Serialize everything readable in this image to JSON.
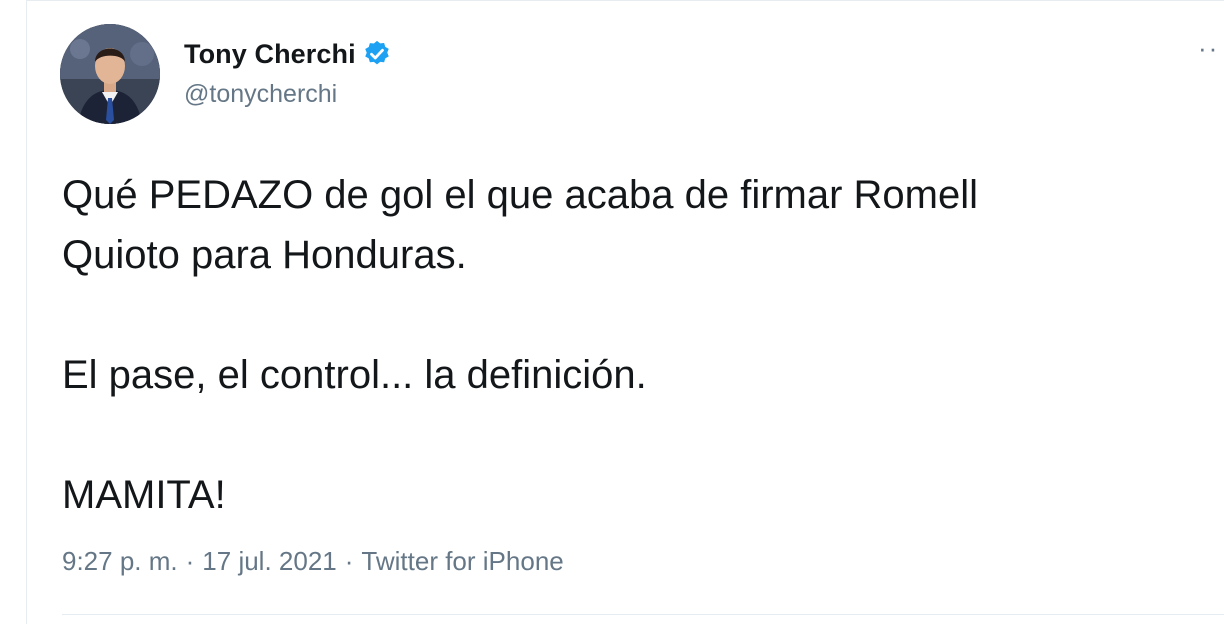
{
  "author": {
    "display_name": "Tony Cherchi",
    "handle": "@tonycherchi",
    "verified": true,
    "avatar_icon": "profile-photo"
  },
  "more_menu": {
    "label": "··",
    "icon": "more-horizontal-icon"
  },
  "tweet": {
    "line1": "Qué PEDAZO de gol el que acaba de firmar Romell",
    "line2": "Quioto para Honduras.",
    "line3": "El pase, el control... la definición.",
    "line4": "MAMITA!"
  },
  "meta": {
    "time": "9:27 p. m.",
    "separator": "·",
    "date": "17 jul. 2021",
    "source": "Twitter for iPhone"
  },
  "colors": {
    "text": "#14171a",
    "secondary": "#657786",
    "verified_blue": "#1da1f2",
    "divider": "#e6ecf0"
  }
}
